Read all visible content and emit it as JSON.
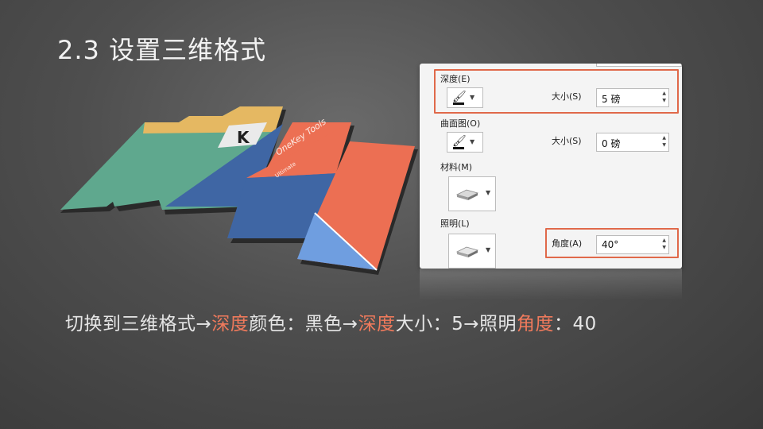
{
  "slide": {
    "title": "2.3 设置三维格式"
  },
  "panel": {
    "depth_label": "深度(E)",
    "contour_label": "曲面图(O)",
    "material_label": "材料(M)",
    "lighting_label": "照明(L)",
    "size_label_1": "大小(S)",
    "size_value_1": "5 磅",
    "size_label_2": "大小(S)",
    "size_value_2": "0 磅",
    "angle_label": "角度(A)",
    "angle_value": "40°",
    "depth_color": "#000000",
    "highlight_color": "#e0694a"
  },
  "illustration": {
    "k_logo": "K",
    "brand_text": "OneKey Tools",
    "brand_sub": "Ultimate",
    "colors": {
      "green": "#5fa88e",
      "yellow": "#e5b862",
      "blue": "#3f66a4",
      "orange": "#ec6f53",
      "lightblue": "#6f9ee0"
    }
  },
  "caption": {
    "part1": "切换到三维格式→",
    "part2": "深度",
    "part3": "颜色：黑色→",
    "part4": "深度",
    "part5": "大小：5→照明",
    "part6": "角度",
    "part7": "：40"
  }
}
